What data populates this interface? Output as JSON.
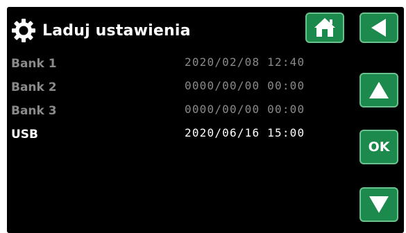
{
  "header": {
    "title": "Laduj ustawienia",
    "icon": "gear-icon"
  },
  "rows": [
    {
      "label": "Bank 1",
      "value": "2020/02/08 12:40",
      "active": false
    },
    {
      "label": "Bank 2",
      "value": "0000/00/00 00:00",
      "active": false
    },
    {
      "label": "Bank 3",
      "value": "0000/00/00 00:00",
      "active": false
    },
    {
      "label": "USB",
      "value": "2020/06/16 15:00",
      "active": true
    }
  ],
  "buttons": {
    "home_icon": "home-icon",
    "back_icon": "back-arrow-icon",
    "up_icon": "arrow-up-icon",
    "ok_label": "OK",
    "down_icon": "arrow-down-icon"
  },
  "colors": {
    "background": "#000000",
    "text_active": "#ffffff",
    "text_inactive": "#8a8a8a",
    "button_fill": "#1c8a4c",
    "button_border": "#6cc28e"
  }
}
